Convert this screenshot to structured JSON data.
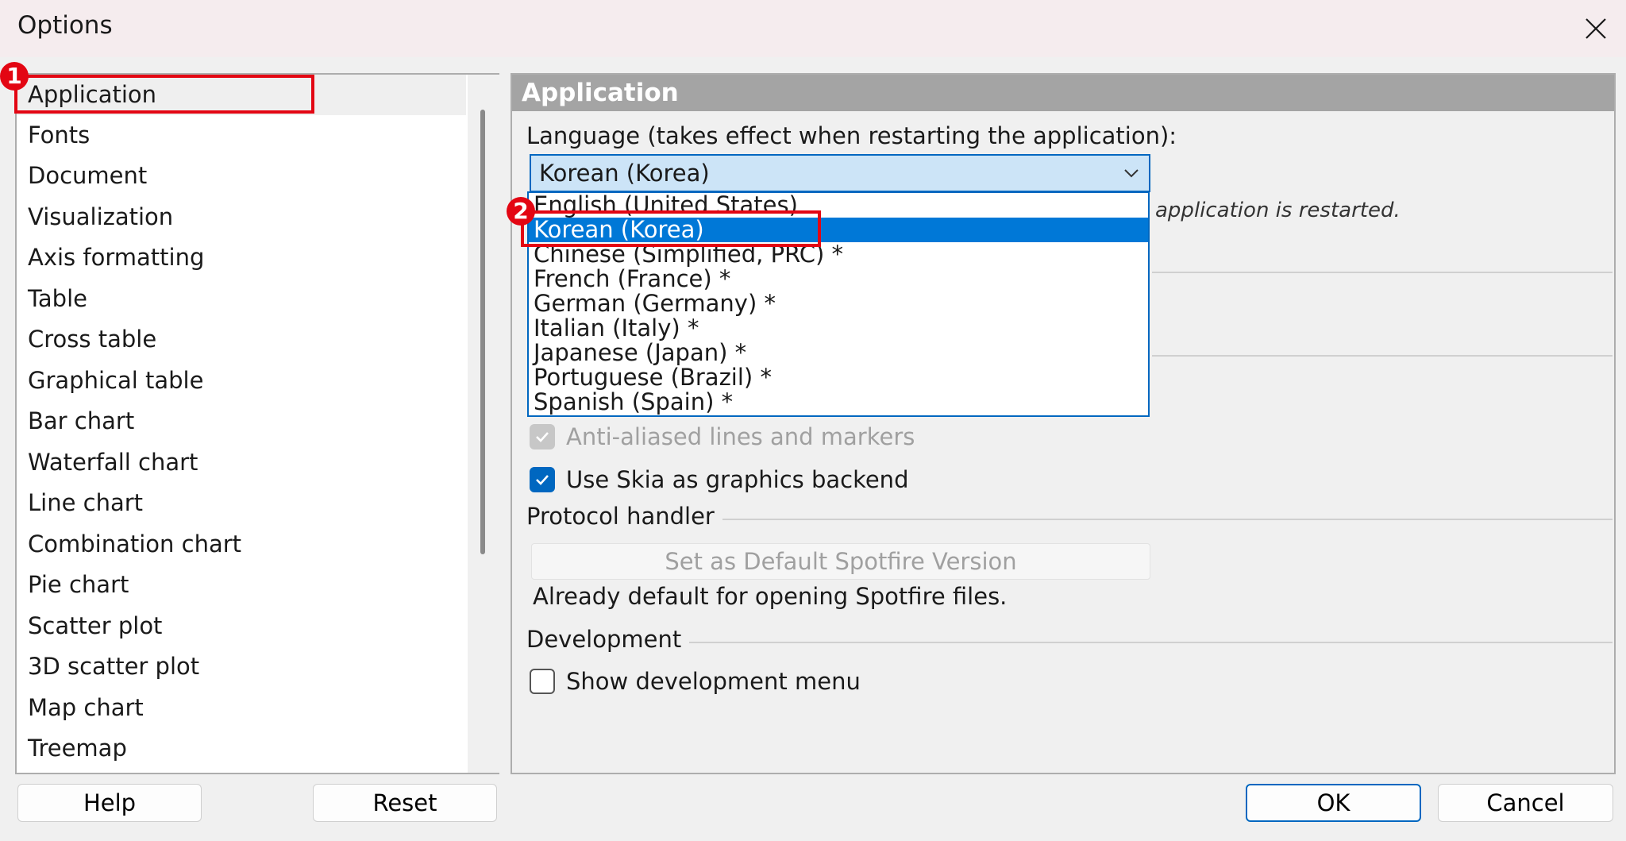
{
  "window": {
    "title": "Options"
  },
  "categories": [
    "Application",
    "Fonts",
    "Document",
    "Visualization",
    "Axis formatting",
    "Table",
    "Cross table",
    "Graphical table",
    "Bar chart",
    "Waterfall chart",
    "Line chart",
    "Combination chart",
    "Pie chart",
    "Scatter plot",
    "3D scatter plot",
    "Map chart",
    "Treemap"
  ],
  "selected_category": "Application",
  "panel": {
    "header": "Application",
    "language_label": "Language (takes effect when restarting the application):",
    "language_selected": "Korean (Korea)",
    "restart_note": "application is restarted.",
    "language_options": [
      "English (United States)",
      "Korean (Korea)",
      "Chinese (Simplified, PRC) *",
      "French (France) *",
      "German (Germany) *",
      "Italian (Italy) *",
      "Japanese (Japan) *",
      "Portuguese (Brazil) *",
      "Spanish (Spain) *"
    ],
    "antialias_label": "Anti-aliased lines and markers",
    "skia_label": "Use Skia as graphics backend",
    "protocol_group": "Protocol handler",
    "default_button": "Set as Default Spotfire Version",
    "default_note": "Already default for opening Spotfire files.",
    "development_group": "Development",
    "dev_menu_label": "Show development menu"
  },
  "buttons": {
    "help": "Help",
    "reset": "Reset",
    "ok": "OK",
    "cancel": "Cancel"
  },
  "annotations": {
    "badge1": "1",
    "badge2": "2"
  },
  "colors": {
    "accent": "#0067c0",
    "selection": "#0078d7",
    "highlight": "#e30613",
    "header": "#a4a4a4"
  }
}
